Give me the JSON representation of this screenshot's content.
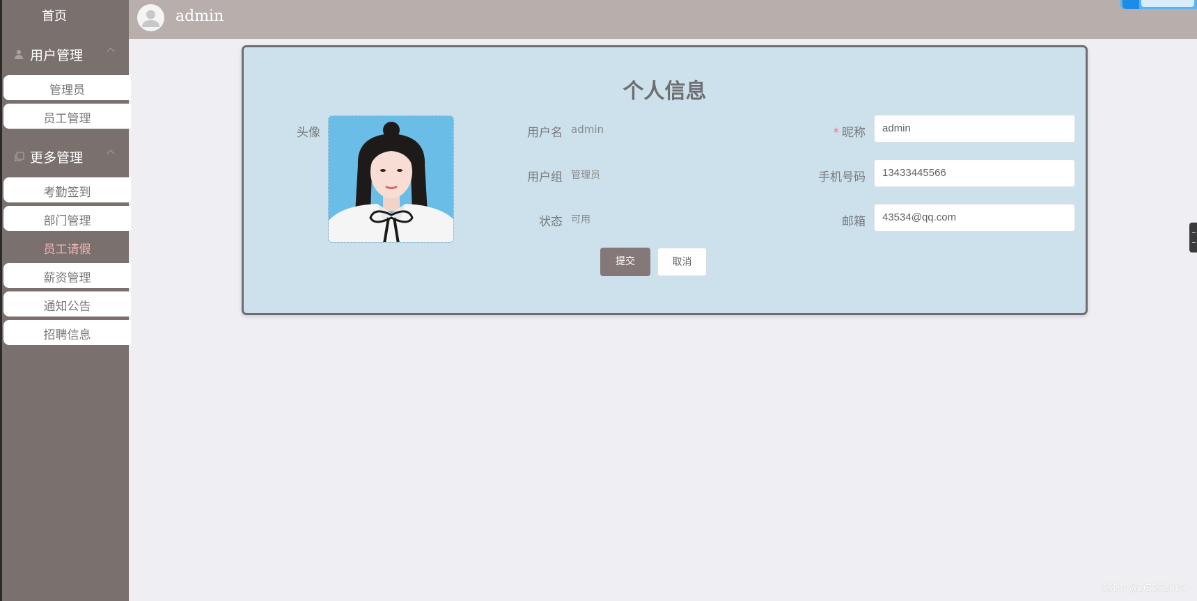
{
  "sidebar": {
    "home": "首页",
    "groups": [
      {
        "label": "用户管理",
        "icon": "user-icon"
      },
      {
        "label": "更多管理",
        "icon": "copy-icon"
      }
    ],
    "items": [
      {
        "label": "管理员"
      },
      {
        "label": "员工管理"
      },
      {
        "label": "考勤签到"
      },
      {
        "label": "部门管理"
      },
      {
        "label": "员工请假",
        "active": true
      },
      {
        "label": "薪资管理"
      },
      {
        "label": "通知公告"
      },
      {
        "label": "招聘信息"
      }
    ]
  },
  "header": {
    "username": "admin"
  },
  "profile": {
    "title": "个人信息",
    "avatar_label": "头像",
    "username_label": "用户名",
    "username_value": "admin",
    "group_label": "用户组",
    "group_value": "管理员",
    "status_label": "状态",
    "status_value": "可用",
    "required_mark": "*",
    "nickname_label": "昵称",
    "nickname_value": "admin",
    "phone_label": "手机号码",
    "phone_value": "13433445566",
    "email_label": "邮箱",
    "email_value": "43534@qq.com",
    "submit_label": "提交",
    "cancel_label": "取消"
  },
  "watermark": "CSDN @DZBS2000",
  "colors": {
    "sidebar_bg": "#7a706d",
    "header_bg": "#b8afad",
    "card_bg": "#cce1ec",
    "submit_bg": "#847978",
    "active_item": "#f2b3b3",
    "required": "#f56c6c"
  }
}
